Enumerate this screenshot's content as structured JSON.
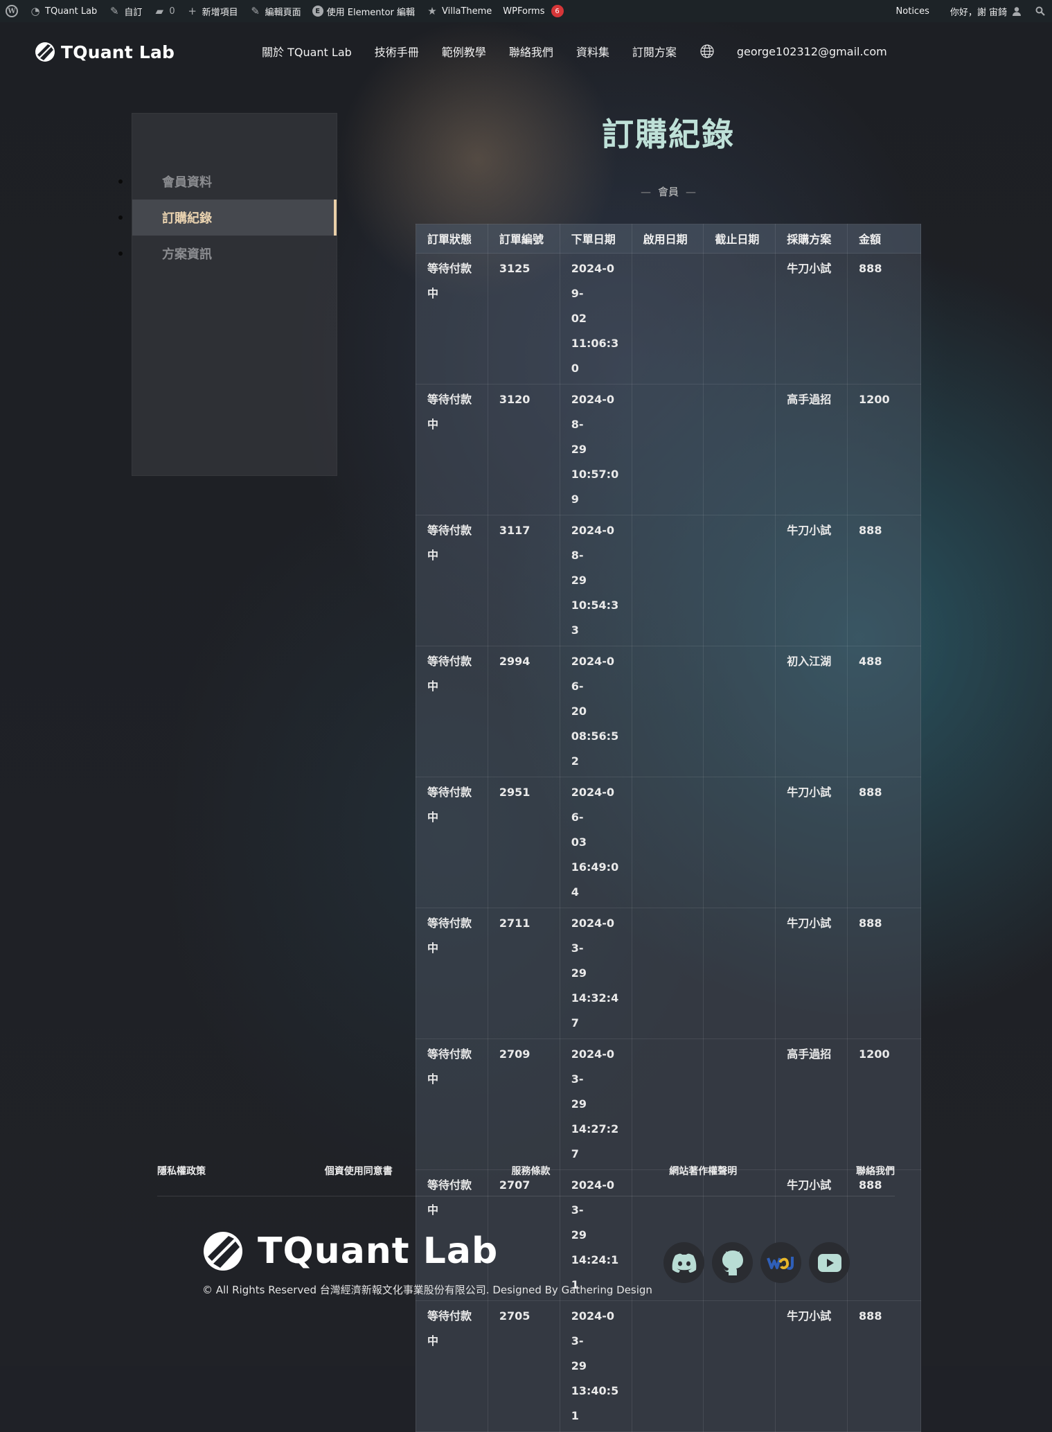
{
  "admin_bar": {
    "site_name": "TQuant Lab",
    "customize": "自訂",
    "comments_count": "0",
    "new_item": "新增項目",
    "edit_page": "編輯頁面",
    "elementor_edit": "使用 Elementor 編輯",
    "villatheme": "VillaTheme",
    "wpforms": "WPForms",
    "wpforms_badge": "6",
    "notices": "Notices",
    "greeting": "你好，謝 宙錡"
  },
  "header": {
    "logo_text": "TQuant Lab",
    "nav": [
      "關於 TQuant Lab",
      "技術手冊",
      "範例教學",
      "聯絡我們",
      "資料集",
      "訂閱方案"
    ],
    "email": "george102312@gmail.com"
  },
  "sidebar": {
    "items": [
      {
        "label": "會員資料"
      },
      {
        "label": "訂購紀錄"
      },
      {
        "label": "方案資訊"
      }
    ]
  },
  "main": {
    "title": "訂購紀錄",
    "role": "會員",
    "role_dash": "—",
    "table": {
      "headers": [
        "訂單狀態",
        "訂單編號",
        "下單日期",
        "啟用日期",
        "截止日期",
        "採購方案",
        "金額"
      ],
      "rows": [
        [
          "等待付款中",
          "3125",
          "2024-09-02 11:06:30",
          "",
          "",
          "牛刀小試",
          "888"
        ],
        [
          "等待付款中",
          "3120",
          "2024-08-29 10:57:09",
          "",
          "",
          "高手過招",
          "1200"
        ],
        [
          "等待付款中",
          "3117",
          "2024-08-29 10:54:33",
          "",
          "",
          "牛刀小試",
          "888"
        ],
        [
          "等待付款中",
          "2994",
          "2024-06-20 08:56:52",
          "",
          "",
          "初入江湖",
          "488"
        ],
        [
          "等待付款中",
          "2951",
          "2024-06-03 16:49:04",
          "",
          "",
          "牛刀小試",
          "888"
        ],
        [
          "等待付款中",
          "2711",
          "2024-03-29 14:32:47",
          "",
          "",
          "牛刀小試",
          "888"
        ],
        [
          "等待付款中",
          "2709",
          "2024-03-29 14:27:27",
          "",
          "",
          "高手過招",
          "1200"
        ],
        [
          "等待付款中",
          "2707",
          "2024-03-29 14:24:11",
          "",
          "",
          "牛刀小試",
          "888"
        ],
        [
          "等待付款中",
          "2705",
          "2024-03-29 13:40:51",
          "",
          "",
          "牛刀小試",
          "888"
        ]
      ]
    }
  },
  "footer": {
    "links": [
      "隱私權政策",
      "個資使用同意書",
      "服務條款",
      "網站著作權聲明",
      "聯絡我們"
    ],
    "logo_text": "TQuant Lab",
    "copyright": "© All Rights Reserved 台灣經濟新報文化事業股份有限公司. Designed By Gathering Design",
    "socials": [
      "discord-icon",
      "github-icon",
      "tej-icon",
      "youtube-icon"
    ]
  },
  "colors": {
    "accent_gold": "#e9cfa8",
    "title_mint": "#bfe1d8",
    "social_icon": "#b9ddd5"
  }
}
